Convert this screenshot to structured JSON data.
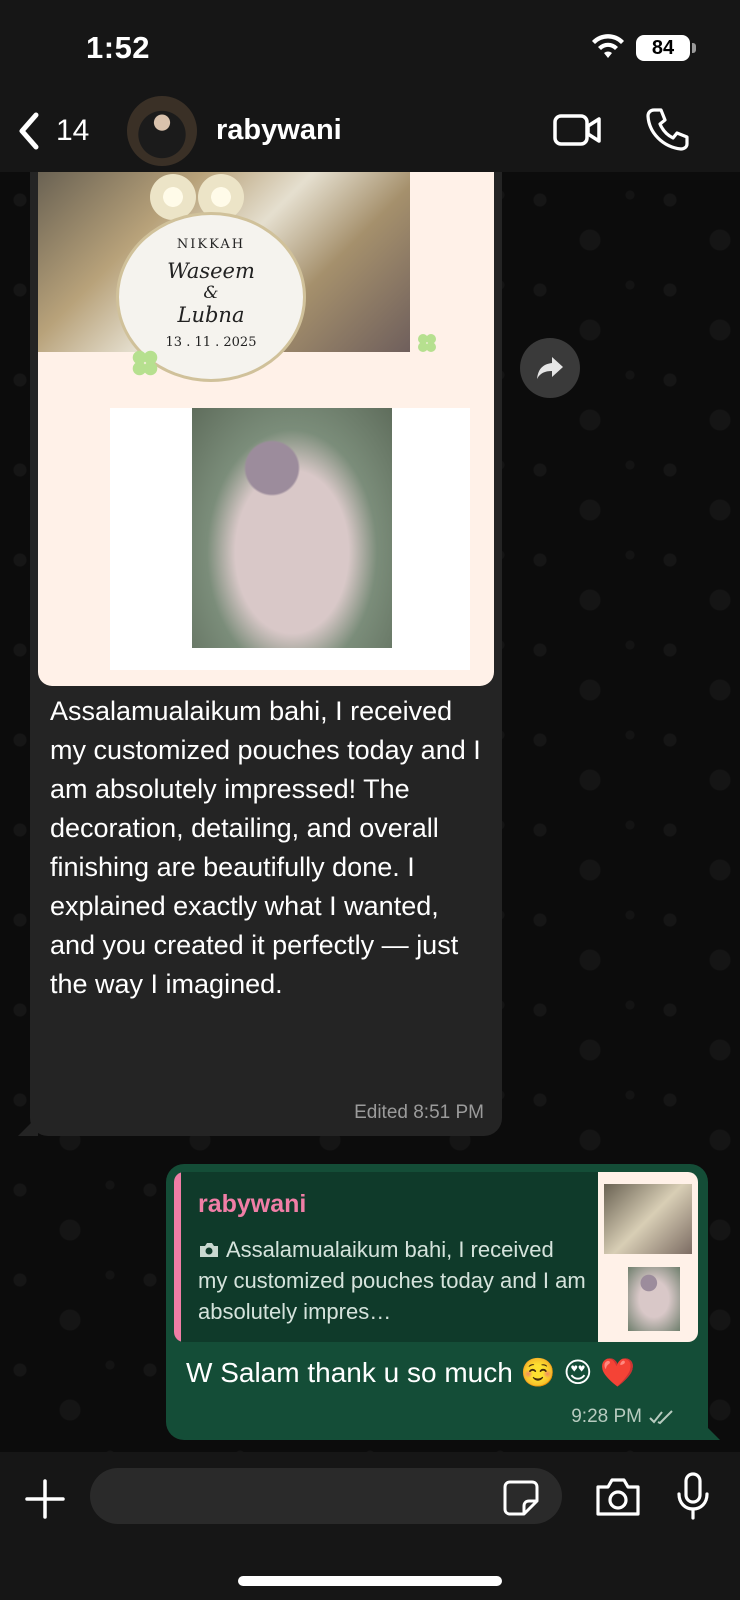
{
  "status_bar": {
    "time": "1:52",
    "battery": "84"
  },
  "header": {
    "back_count": "14",
    "contact_name": "rabywani"
  },
  "incoming": {
    "media": {
      "seal_title": "NIKKAH",
      "seal_name_1": "Waseem",
      "seal_amp": "&",
      "seal_name_2": "Lubna",
      "seal_date": "13 . 11 . 2025"
    },
    "text": "Assalamualaikum bahi, I received my customized pouches today and I am absolutely impressed! The decoration, detailing, and overall finishing are beautifully done. I explained exactly what I wanted, and you created it perfectly — just the way I imagined.",
    "meta": "Edited 8:51 PM"
  },
  "outgoing": {
    "quote_author": "rabywani",
    "quote_text": "Assalamualaikum bahi, I received my customized pouches today and I am absolutely impres…",
    "text": "W Salam thank u so much ☺️ 😍 ❤️",
    "time": "9:28 PM"
  },
  "input": {
    "placeholder": ""
  },
  "icons": {
    "back": "chevron-left-icon",
    "video": "video-camera-icon",
    "call": "phone-icon",
    "forward": "forward-arrow-icon",
    "plus": "plus-icon",
    "sticker": "sticker-icon",
    "camera": "camera-icon",
    "mic": "microphone-icon",
    "read": "double-check-icon"
  },
  "colors": {
    "incoming_bubble": "#242424",
    "outgoing_bubble": "#144d37",
    "quote_accent": "#f07ea6",
    "bar_background": "#161616"
  }
}
